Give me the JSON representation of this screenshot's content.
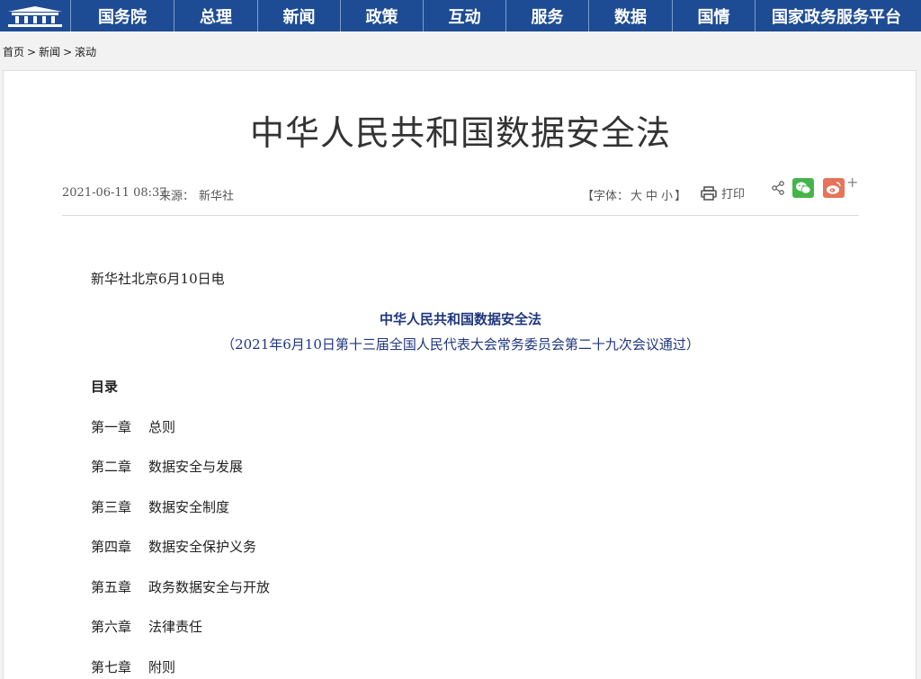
{
  "nav": {
    "items": [
      "国务院",
      "总理",
      "新闻",
      "政策",
      "互动",
      "服务",
      "数据",
      "国情",
      "国家政务服务平台"
    ]
  },
  "breadcrumb": {
    "home": "首页",
    "news": "新闻",
    "rolling": "滚动",
    "separator": ">"
  },
  "article": {
    "title": "中华人民共和国数据安全法",
    "date": "2021-06-11 08:37",
    "source_label": "来源：",
    "source": "新华社",
    "font_label": "【字体：",
    "font_large": "大",
    "font_medium": "中",
    "font_small": "小",
    "font_close": "】",
    "print_label": "打印",
    "share_plus": "+",
    "dateline": "新华社北京6月10日电",
    "law_title": "中华人民共和国数据安全法",
    "law_subtitle": "（2021年6月10日第十三届全国人民代表大会常务委员会第二十九次会议通过）",
    "toc_heading": "目录",
    "chapters": [
      {
        "num": "第一章",
        "name": "总则"
      },
      {
        "num": "第二章",
        "name": "数据安全与发展"
      },
      {
        "num": "第三章",
        "name": "数据安全制度"
      },
      {
        "num": "第四章",
        "name": "数据安全保护义务"
      },
      {
        "num": "第五章",
        "name": "政务数据安全与开放"
      },
      {
        "num": "第六章",
        "name": "法律责任"
      },
      {
        "num": "第七章",
        "name": "附则"
      }
    ]
  },
  "colors": {
    "nav_bg": "#1e4c94",
    "law_title": "#1f3680",
    "wechat": "#44b549",
    "weibo": "#e5745a"
  }
}
